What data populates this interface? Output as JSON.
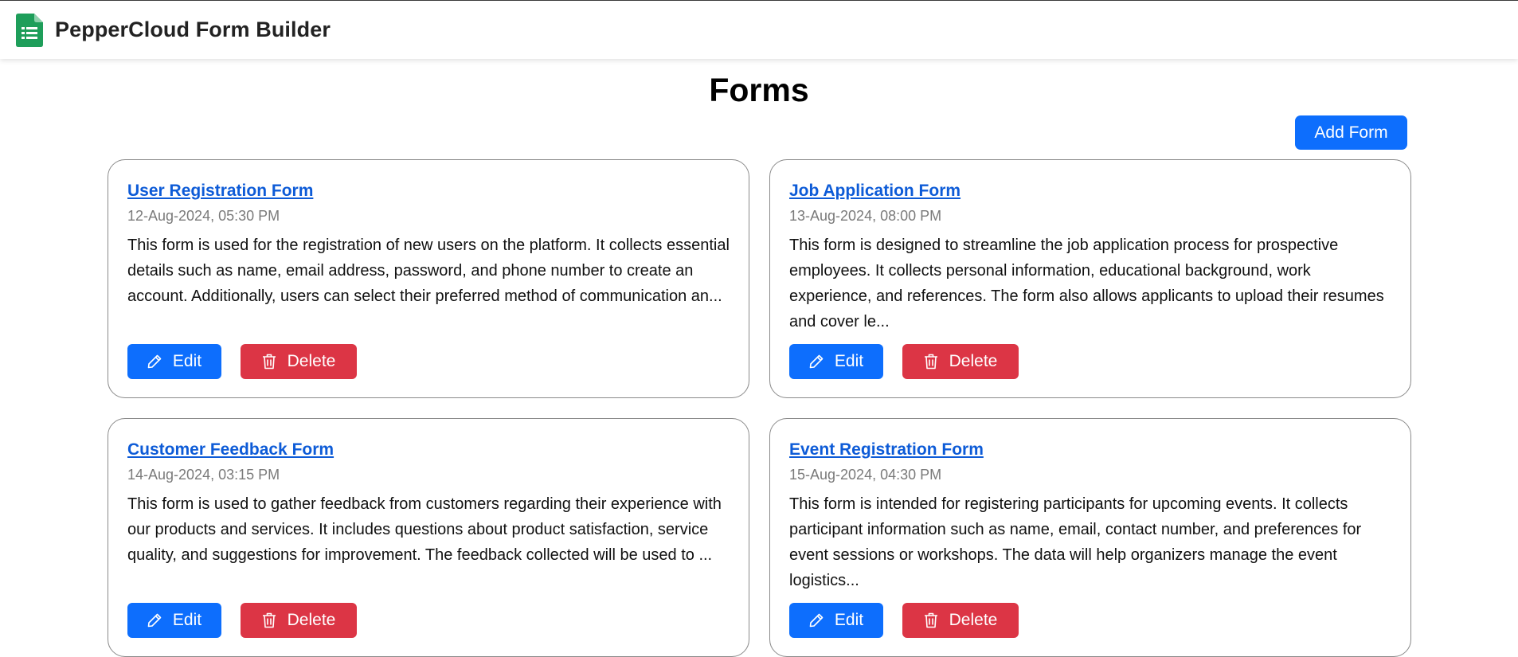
{
  "app": {
    "title": "PepperCloud Form Builder",
    "icon": "sheets-icon",
    "brand_color": "#1e9e5a"
  },
  "page": {
    "title": "Forms",
    "add_button_label": "Add Form"
  },
  "colors": {
    "primary": "#0d6efd",
    "danger": "#dc3545",
    "link": "#0d5bd7",
    "muted": "#7a7a7a"
  },
  "forms": [
    {
      "title": "User Registration Form",
      "date": "12-Aug-2024, 05:30 PM",
      "description": "This form is used for the registration of new users on the platform. It collects essential details such as name, email address, password, and phone number to create an account. Additionally, users can select their preferred method of communication an...",
      "edit_label": "Edit",
      "delete_label": "Delete"
    },
    {
      "title": "Job Application Form",
      "date": "13-Aug-2024, 08:00 PM",
      "description": "This form is designed to streamline the job application process for prospective employees. It collects personal information, educational background, work experience, and references. The form also allows applicants to upload their resumes and cover le...",
      "edit_label": "Edit",
      "delete_label": "Delete"
    },
    {
      "title": "Customer Feedback Form",
      "date": "14-Aug-2024, 03:15 PM",
      "description": "This form is used to gather feedback from customers regarding their experience with our products and services. It includes questions about product satisfaction, service quality, and suggestions for improvement. The feedback collected will be used to ...",
      "edit_label": "Edit",
      "delete_label": "Delete"
    },
    {
      "title": "Event Registration Form",
      "date": "15-Aug-2024, 04:30 PM",
      "description": "This form is intended for registering participants for upcoming events. It collects participant information such as name, email, contact number, and preferences for event sessions or workshops. The data will help organizers manage the event logistics...",
      "edit_label": "Edit",
      "delete_label": "Delete"
    }
  ]
}
